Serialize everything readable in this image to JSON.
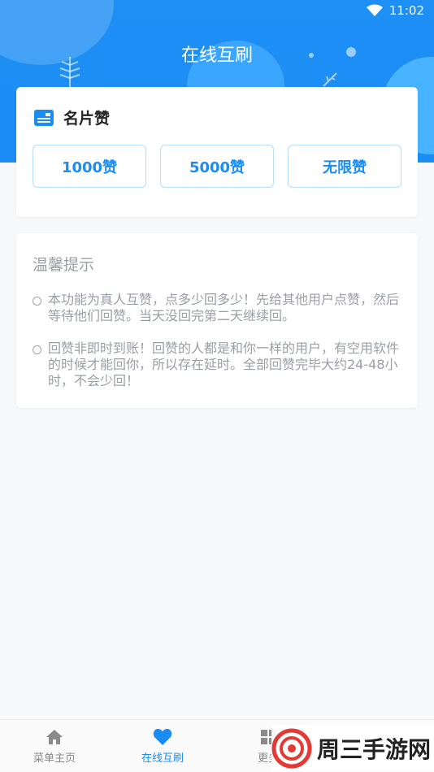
{
  "status_bar": {
    "time": "11:02"
  },
  "header": {
    "title": "在线互刷"
  },
  "card": {
    "title": "名片赞",
    "buttons": [
      {
        "label": "1000赞"
      },
      {
        "label": "5000赞"
      },
      {
        "label": "无限赞"
      }
    ]
  },
  "tips": {
    "title": "温馨提示",
    "items": [
      "本功能为真人互赞，点多少回多少！先给其他用户点赞，然后等待他们回赞。当天没回完第二天继续回。",
      "回赞非即时到账！回赞的人都是和你一样的用户，有空用软件的时候才能回你，所以存在延时。全部回赞完毕大约24-48小时，不会少回！"
    ]
  },
  "tabs": [
    {
      "label": "菜单主页",
      "icon": "home-icon"
    },
    {
      "label": "在线互刷",
      "icon": "heart-icon",
      "active": true
    },
    {
      "label": "更多",
      "icon": "grid-icon"
    }
  ],
  "watermark": {
    "text": "周三手游网"
  },
  "colors": {
    "primary": "#1a8cf4",
    "text_muted": "#9a9ea5"
  }
}
